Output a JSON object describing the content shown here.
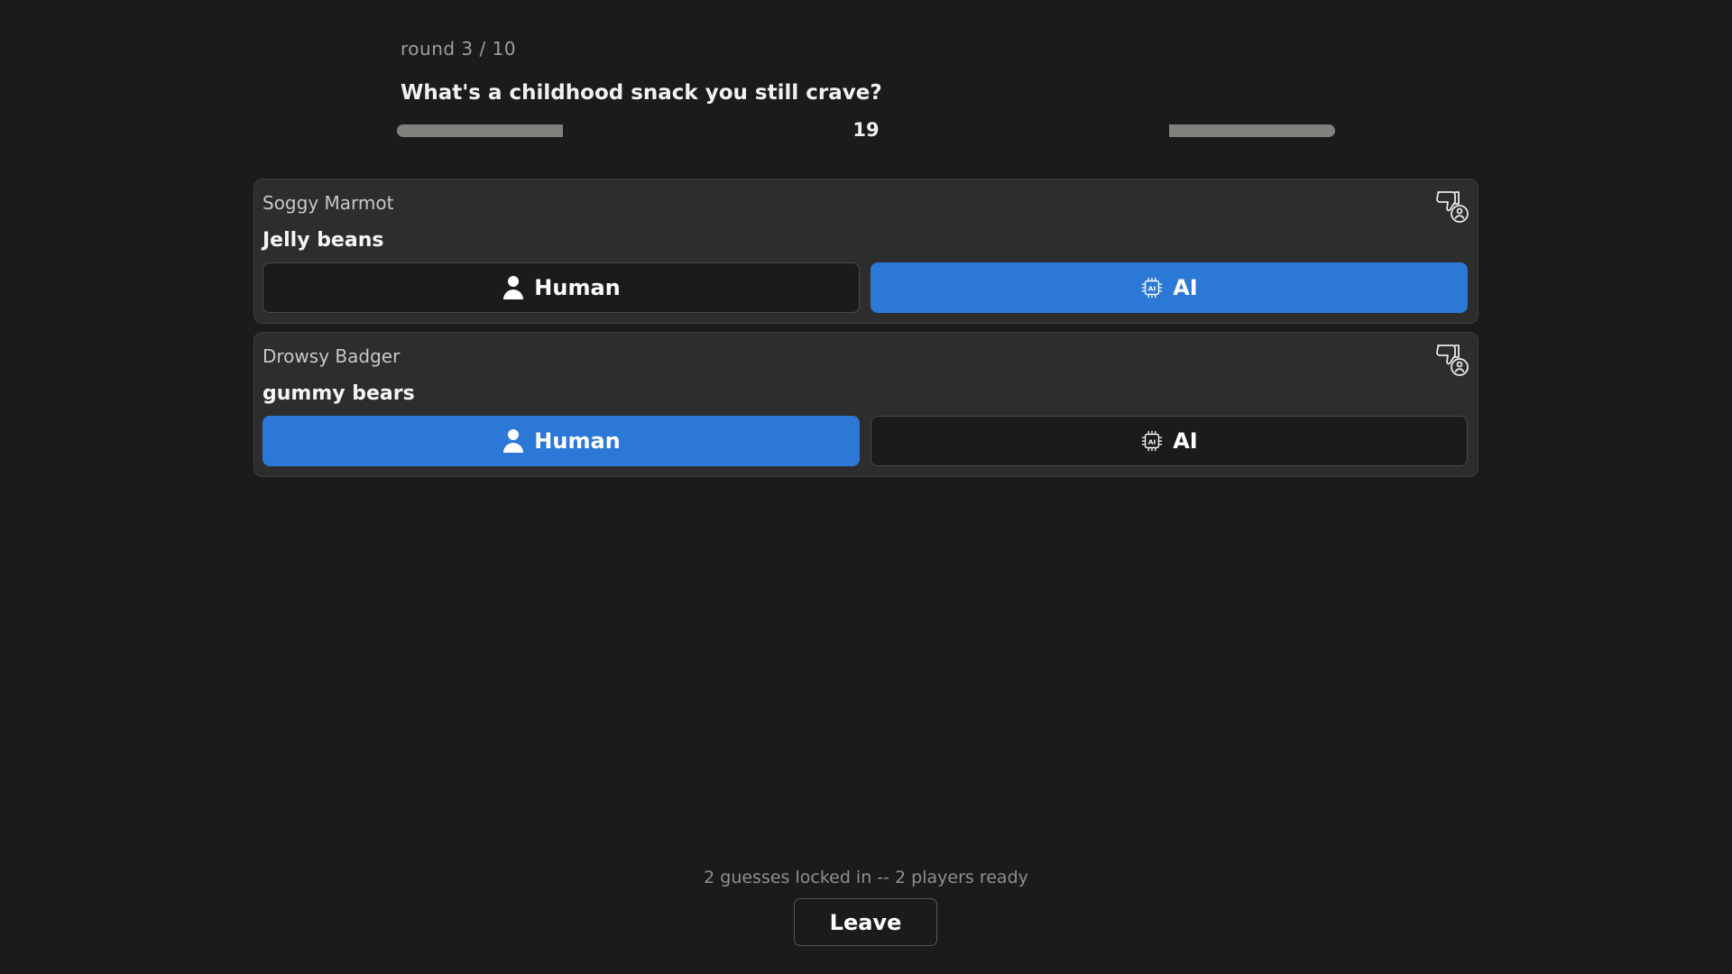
{
  "round": {
    "label": "round 3 / 10"
  },
  "question": "What's a childhood snack you still crave?",
  "timer": {
    "value": "19",
    "fill_fraction_each_side": 0.177,
    "color": "#7f817c"
  },
  "accent_color": "#2c78d6",
  "cards": [
    {
      "player": "Soggy Marmot",
      "answer": "Jelly beans",
      "report_icon": "thumbs-down-with-person-icon",
      "human_label": "Human",
      "ai_label": "AI",
      "selected": "AI"
    },
    {
      "player": "Drowsy Badger",
      "answer": "gummy bears",
      "report_icon": "thumbs-down-with-person-icon",
      "human_label": "Human",
      "ai_label": "AI",
      "selected": "Human"
    }
  ],
  "status": "2 guesses locked in -- 2 players ready",
  "leave_label": "Leave"
}
